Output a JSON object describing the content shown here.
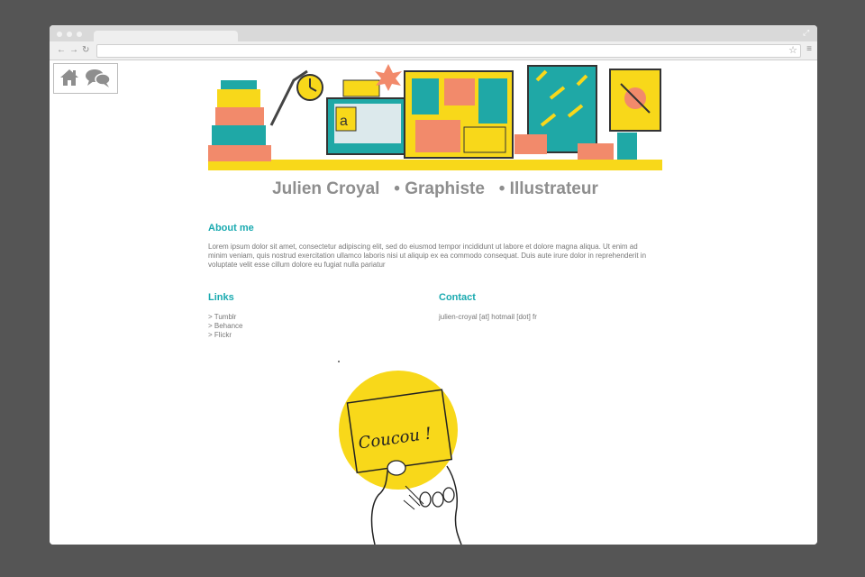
{
  "page": {
    "title_parts": [
      "Julien Croyal",
      "• Graphiste",
      "• Illustrateur"
    ]
  },
  "about": {
    "heading": "About me",
    "text": "Lorem ipsum dolor sit amet, consectetur adipiscing elit, sed do eiusmod tempor incididunt ut labore et dolore magna aliqua. Ut enim ad minim veniam, quis nostrud exercitation ullamco laboris nisi ut aliquip ex ea commodo consequat. Duis aute irure dolor in reprehenderit in voluptate velit esse cillum dolore eu fugiat nulla pariatur"
  },
  "links": {
    "heading": "Links",
    "items": [
      "> Tumblr",
      "> Behance",
      "> Flickr"
    ]
  },
  "contact": {
    "heading": "Contact",
    "email": "julien-croyal [at] hotmail [dot] fr"
  },
  "illustration": {
    "card_text": "Coucou !"
  },
  "icons": {
    "home": "home-icon",
    "chat": "speech-bubbles-icon"
  },
  "colors": {
    "accent": "#1aaab0",
    "yellow": "#f8d81a",
    "teal": "#1fa8a6",
    "coral": "#f28a6b",
    "text_gray": "#8e8e8e"
  }
}
